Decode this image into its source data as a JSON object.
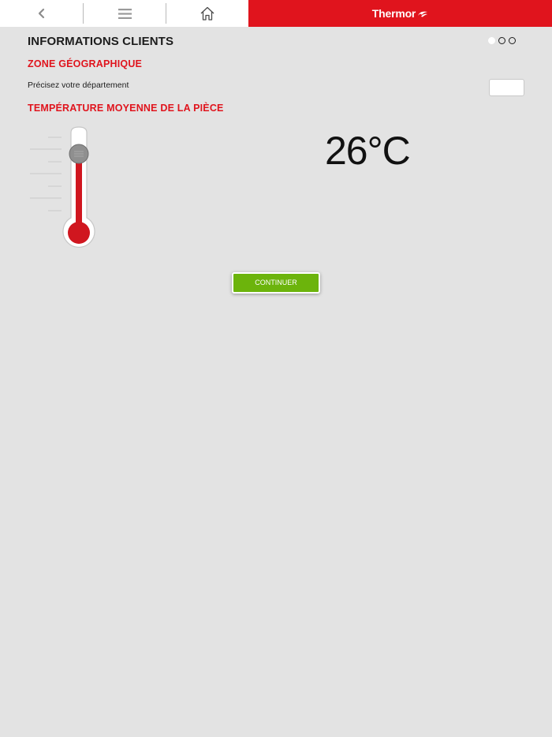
{
  "nav": {
    "back_icon": "chevron-left-icon",
    "menu_icon": "hamburger-menu-icon",
    "home_icon": "home-icon",
    "brand_name": "Thermor",
    "brand_color": "#e0141d"
  },
  "header": {
    "title": "INFORMATIONS CLIENTS",
    "steps_total": 3,
    "step_current": 1
  },
  "zone": {
    "heading": "ZONE GÉOGRAPHIQUE",
    "label": "Précisez votre département",
    "value": "",
    "placeholder": ""
  },
  "temperature": {
    "heading": "TEMPÉRATURE MOYENNE DE LA PIÈCE",
    "value_text": "26°C",
    "slider_level_fraction": 0.75,
    "thermometer_icon": "thermometer-slider-icon"
  },
  "actions": {
    "continue_label": "CONTINUER",
    "continue_color": "#6cb40c"
  }
}
